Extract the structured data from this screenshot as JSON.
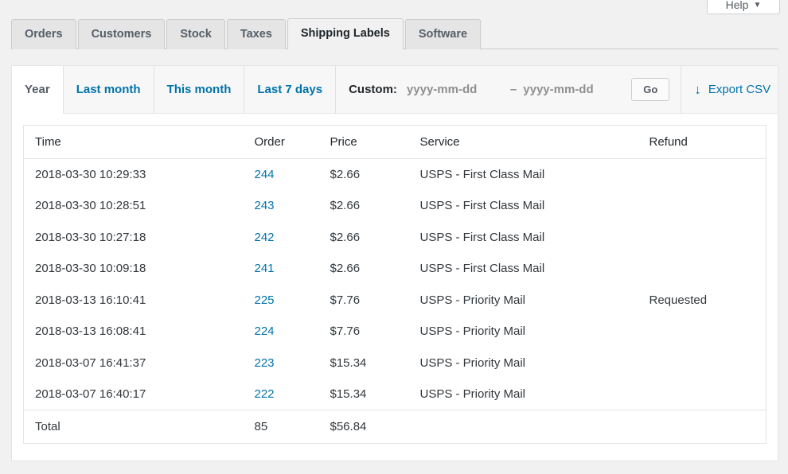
{
  "help": {
    "label": "Help",
    "caret": "▼"
  },
  "nav": {
    "tabs": [
      {
        "label": "Orders",
        "active": false
      },
      {
        "label": "Customers",
        "active": false
      },
      {
        "label": "Stock",
        "active": false
      },
      {
        "label": "Taxes",
        "active": false
      },
      {
        "label": "Shipping Labels",
        "active": true
      },
      {
        "label": "Software",
        "active": false
      }
    ]
  },
  "range_bar": {
    "ranges": [
      {
        "label": "Year",
        "current": true
      },
      {
        "label": "Last month",
        "current": false
      },
      {
        "label": "This month",
        "current": false
      },
      {
        "label": "Last 7 days",
        "current": false
      }
    ],
    "custom_label": "Custom:",
    "date_from_placeholder": "yyyy-mm-dd",
    "date_from_value": "",
    "date_separator": "–",
    "date_to_placeholder": "yyyy-mm-dd",
    "date_to_value": "",
    "go_label": "Go",
    "export_arrow": "↓",
    "export_label": "Export CSV"
  },
  "table": {
    "headers": {
      "time": "Time",
      "order": "Order",
      "price": "Price",
      "service": "Service",
      "refund": "Refund"
    },
    "rows": [
      {
        "time": "2018-03-30 10:29:33",
        "order": "244",
        "price": "$2.66",
        "service": "USPS - First Class Mail",
        "refund": ""
      },
      {
        "time": "2018-03-30 10:28:51",
        "order": "243",
        "price": "$2.66",
        "service": "USPS - First Class Mail",
        "refund": ""
      },
      {
        "time": "2018-03-30 10:27:18",
        "order": "242",
        "price": "$2.66",
        "service": "USPS - First Class Mail",
        "refund": ""
      },
      {
        "time": "2018-03-30 10:09:18",
        "order": "241",
        "price": "$2.66",
        "service": "USPS - First Class Mail",
        "refund": ""
      },
      {
        "time": "2018-03-13 16:10:41",
        "order": "225",
        "price": "$7.76",
        "service": "USPS - Priority Mail",
        "refund": "Requested"
      },
      {
        "time": "2018-03-13 16:08:41",
        "order": "224",
        "price": "$7.76",
        "service": "USPS - Priority Mail",
        "refund": ""
      },
      {
        "time": "2018-03-07 16:41:37",
        "order": "223",
        "price": "$15.34",
        "service": "USPS - Priority Mail",
        "refund": ""
      },
      {
        "time": "2018-03-07 16:40:17",
        "order": "222",
        "price": "$15.34",
        "service": "USPS - Priority Mail",
        "refund": ""
      }
    ],
    "total": {
      "label": "Total",
      "order_count": "85",
      "price_sum": "$56.84",
      "service": "",
      "refund": ""
    }
  },
  "colors": {
    "link": "#0073aa",
    "text": "#32373c",
    "muted": "#8f8f8f",
    "page_bg": "#f1f1f1",
    "panel_bg": "#ffffff",
    "border": "#e5e5e5"
  }
}
